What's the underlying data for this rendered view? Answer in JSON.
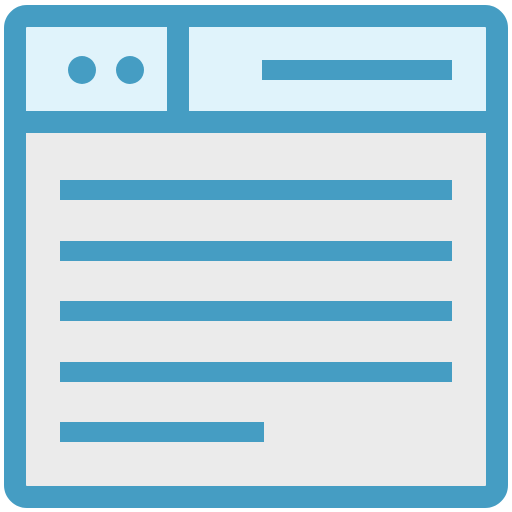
{
  "icon": {
    "name": "browser-window-document-icon",
    "colors": {
      "stroke": "#459DC3",
      "header_fill": "#E0F3FB",
      "body_fill": "#EBEBEB"
    },
    "header": {
      "dots": [
        "window-dot",
        "window-dot"
      ],
      "title_bar": "address-bar-line"
    },
    "content_lines": [
      {
        "name": "text-line",
        "length": 1.0
      },
      {
        "name": "text-line",
        "length": 1.0
      },
      {
        "name": "text-line",
        "length": 1.0
      },
      {
        "name": "text-line",
        "length": 1.0
      },
      {
        "name": "text-line",
        "length": 0.52
      }
    ]
  }
}
